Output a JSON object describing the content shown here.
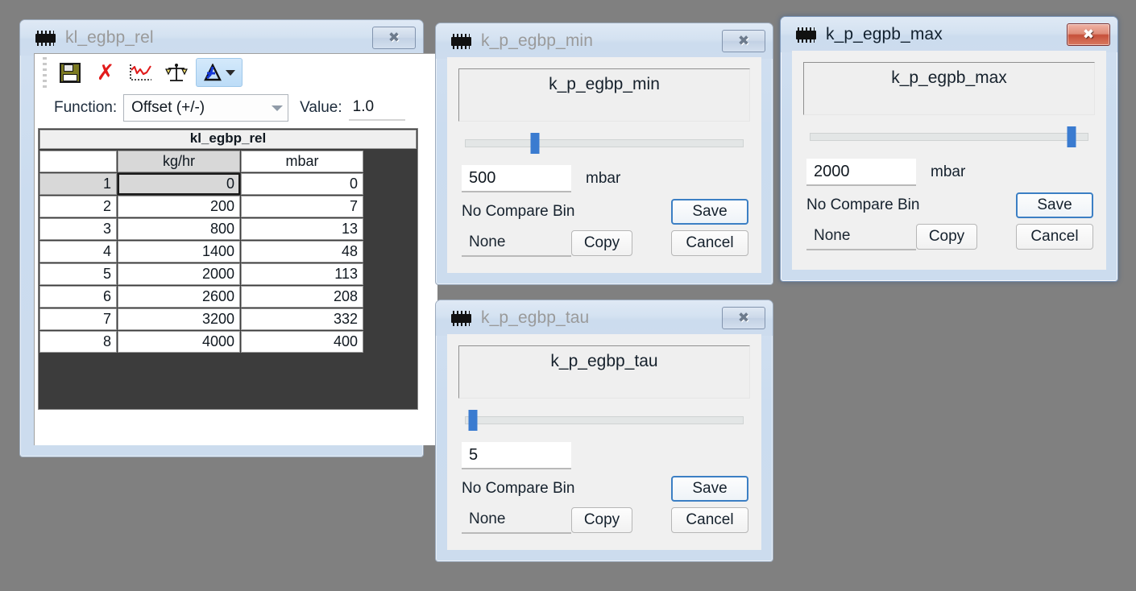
{
  "desktop": {
    "background": "#808080"
  },
  "windows": {
    "table_editor": {
      "title": "kl_egbp_rel",
      "close_label": "✖",
      "toolbar": {
        "save_icon": "floppy-save-icon",
        "delete_icon": "red-x-delete-icon",
        "curve_icon": "curve-plot-icon",
        "compare_icon": "scales-compare-icon",
        "delta_icon": "delta-tool-icon",
        "delta_dropdown": "chevron-down-icon"
      },
      "function_row": {
        "label": "Function:",
        "selected": "Offset (+/-)",
        "options": [
          "Offset (+/-)"
        ],
        "value_label": "Value:",
        "value": "1.0"
      },
      "grid": {
        "title": "kl_egbp_rel",
        "columns": [
          "",
          "kg/hr",
          "mbar"
        ],
        "rows": [
          {
            "index": "1",
            "x": "0",
            "y": "0"
          },
          {
            "index": "2",
            "x": "200",
            "y": "7"
          },
          {
            "index": "3",
            "x": "800",
            "y": "13"
          },
          {
            "index": "4",
            "x": "1400",
            "y": "48"
          },
          {
            "index": "5",
            "x": "2000",
            "y": "113"
          },
          {
            "index": "6",
            "x": "2600",
            "y": "208"
          },
          {
            "index": "7",
            "x": "3200",
            "y": "332"
          },
          {
            "index": "8",
            "x": "4000",
            "y": "400"
          }
        ],
        "selected_cell": {
          "row": "1",
          "column": "kg/hr",
          "value": "0"
        }
      }
    },
    "min_dialog": {
      "title": "k_p_egbp_min",
      "close_label": "✖",
      "name_label": "k_p_egbp_min",
      "slider_percent": 25,
      "value": "500",
      "unit": "mbar",
      "compare_label": "No Compare Bin",
      "compare_selected": "None",
      "copy_label": "Copy",
      "save_label": "Save",
      "cancel_label": "Cancel"
    },
    "max_dialog": {
      "title": "k_p_egpb_max",
      "close_label": "✖",
      "active": true,
      "name_label": "k_p_egpb_max",
      "slider_percent": 94,
      "value": "2000",
      "unit": "mbar",
      "compare_label": "No Compare Bin",
      "compare_selected": "None",
      "copy_label": "Copy",
      "save_label": "Save",
      "cancel_label": "Cancel"
    },
    "tau_dialog": {
      "title": "k_p_egbp_tau",
      "close_label": "✖",
      "name_label": "k_p_egbp_tau",
      "slider_percent": 3,
      "value": "5",
      "unit": "",
      "compare_label": "No Compare Bin",
      "compare_selected": "None",
      "copy_label": "Copy",
      "save_label": "Save",
      "cancel_label": "Cancel"
    }
  },
  "colors": {
    "accent_blue": "#3a7bd0",
    "close_red": "#c6503a",
    "grid_empty": "#3c3c3c",
    "titlebar": "#ccdcee"
  }
}
